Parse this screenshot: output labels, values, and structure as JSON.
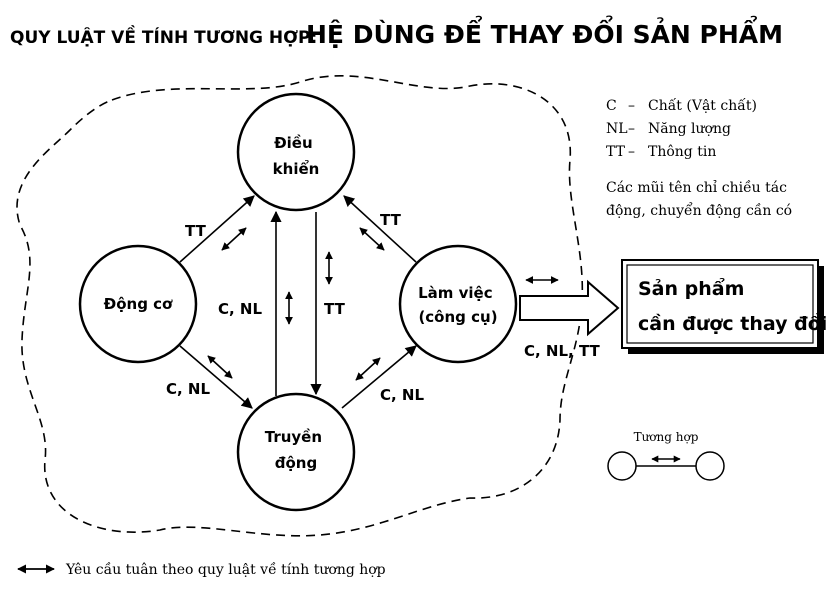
{
  "title": {
    "prefix": "QUY LUẬT VỀ TÍNH TƯƠNG HỢP:",
    "main": "HỆ DÙNG ĐỂ THAY ĐỔI SẢN PHẨM"
  },
  "nodes": {
    "control": [
      "Điều",
      "khiển"
    ],
    "engine": [
      "Động cơ"
    ],
    "working": [
      "Làm việc",
      "(công cụ)"
    ],
    "transmission": [
      "Truyền",
      "động"
    ]
  },
  "edge_labels": {
    "engine_control": "TT",
    "control_working": "TT",
    "trans_control_up": "C, NL",
    "control_trans_down": "TT",
    "engine_trans": "C, NL",
    "trans_working": "C, NL",
    "to_product": "C, NL, TT"
  },
  "product": [
    "Sản phẩm",
    "cần được thay đổi"
  ],
  "legend": {
    "items": [
      {
        "abbr": "C",
        "dash": "–",
        "text": "Chất (Vật chất)"
      },
      {
        "abbr": "NL",
        "dash": "–",
        "text": "Năng lượng"
      },
      {
        "abbr": "TT",
        "dash": "–",
        "text": "Thông tin"
      }
    ],
    "note": [
      "Các mũi tên chỉ chiều tác",
      "động, chuyển động cần có"
    ]
  },
  "compat_label": "Tương hợp",
  "footnote": "Yêu cầu tuân theo quy luật về tính tương hợp"
}
